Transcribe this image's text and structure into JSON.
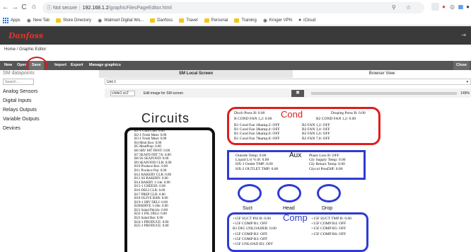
{
  "browser": {
    "back": "←",
    "forward": "→",
    "reload": "C",
    "home": "⌂",
    "security_label": "Not secure",
    "url_host": "192.168.1.2",
    "url_path": "/graphicFilesPageEditor.html"
  },
  "bookmarks": [
    {
      "label": "Apps",
      "kind": "apps"
    },
    {
      "label": "New Tab",
      "kind": "globe"
    },
    {
      "label": "Store Directory",
      "kind": "folder"
    },
    {
      "label": "Walmart Digital Wo...",
      "kind": "globe"
    },
    {
      "label": "Danfoss",
      "kind": "folder"
    },
    {
      "label": "Travel",
      "kind": "folder"
    },
    {
      "label": "Personal",
      "kind": "folder"
    },
    {
      "label": "Training",
      "kind": "folder"
    },
    {
      "label": "Kroger VPN",
      "kind": "globe"
    },
    {
      "label": "iCloud",
      "kind": "apple"
    }
  ],
  "app": {
    "logo": "Danfoss",
    "breadcrumb": "Home / Graphic Editor"
  },
  "toolbar": {
    "buttons": [
      "New",
      "Open",
      "Save",
      "Import",
      "Export",
      "Manage graphics"
    ],
    "close": "Close"
  },
  "sidebar": {
    "title": "SM datapoints",
    "search_placeholder": "Search ...",
    "items": [
      "Analog Sensors",
      "Digital Inputs",
      "Relays Outputs",
      "Variable Outputs",
      "Devices"
    ]
  },
  "tabs": {
    "active": "SM Local Screen",
    "inactive": "Browser View"
  },
  "unit_select": "Unit 1",
  "editor": {
    "file": "c/site1.sc2",
    "label": "Edit image for SM screen",
    "zoom": "149%",
    "zoom_fraction": 0.49
  },
  "graphic": {
    "circuits_title": "Circuits",
    "circuits": [
      "B1-1 Cold Cuts: 0.00",
      "B2-1 Fresh Meat: 0.00",
      "B3-1 Fresh Meat: 0.00",
      "B4 Meat Box: 0.00",
      "B5 MeatPrep: 0.00",
      "B6 SRV MT FRNT: 0.00",
      "B7 SEAFD FRT 7A: 0.00",
      "B8 SS SEAFOOD: 0.00",
      "B9 SEAFOOD CLR: 0.00",
      "B10 Produce Box: 0.00",
      "B11 Produce Prp: 0.00",
      "B12 BAKERY CLR: 0.00",
      "B13 SS BAKERY: 0.00",
      "B14 BAKRY 1-14e: 0.00",
      "B15-1 CHEESE: 0.00",
      "B16 DELI CLR: 0.00",
      "B17 PREP CLR: 0.00",
      "B18 OLIVE BAR: 0.00",
      "B19-1 SRV DELI: 0.00",
      "B20SERVE 1-20e: 0.00",
      "B21 Salad Pdct2e: 0.00",
      "B22-1 INL DELI: 0.00",
      "B23 Salad Bar: 0.00",
      "B24-1 PRODUCE: 0.00",
      "B25-1 PRODUCE: 0.00"
    ],
    "cond": {
      "title": "Cond",
      "disch": "Disch Press B: 0.00",
      "dropleg": "Dropleg Press B: 0.00",
      "fan12a": "B COND FAN 1,2: 0.00",
      "fan12b": "B2 COND FAN 1,2: 0.00",
      "left": [
        "B1 Cond Fan 1&amp;2: OFF",
        "B1 Cond Fan 3&amp;4: OFF",
        "B1 Cond Fan 5&amp;6: OFF",
        "B1 Cond Fan 7&amp;8: OFF"
      ],
      "right": [
        "B2 FAN 1,2: OFF",
        "B2 FAN 3,4: OFF",
        "B2 FAN 5,6: OFF",
        "B2 FAN 7,8: OFF"
      ]
    },
    "aux": {
      "title": "Aux",
      "left": [
        "Outside Temp: 0.00",
        "Liquid Lvl % B: 0.00",
        "HX-1 Outlet TMP: 0.00",
        "HX-2 OUTLET TMP: 0.00"
      ],
      "right": [
        "Phase Loss B: OFF",
        "Gly Supply Temp: 0.00",
        "Gly Return Temp: 0.00",
        "Glycol PresDiff: 0.00"
      ]
    },
    "circles": [
      "Suct",
      "Head",
      "Drop"
    ],
    "comp": {
      "title": "Comp",
      "left": [
        "+15F SUCT PSI B: 0.00",
        "+15F COMP B1: OFF",
        "B1 DIG UNLOADER: 0.00",
        "+15F COMP B2: OFF",
        "+15F COMP B3: OFF",
        "+15F UNLOAD B3: OFF"
      ],
      "right": [
        "+15F SUCT TMP B: 0.00",
        "+15F COMP B4: OFF",
        "+15F COMP B5: OFF",
        "+15F COMP B6: OFF"
      ]
    }
  },
  "colors": {
    "danfoss_red": "#e4342b",
    "cond_red": "#e01c1c",
    "panel_blue": "#2e3cd1",
    "highlight": "#d61c1c"
  }
}
